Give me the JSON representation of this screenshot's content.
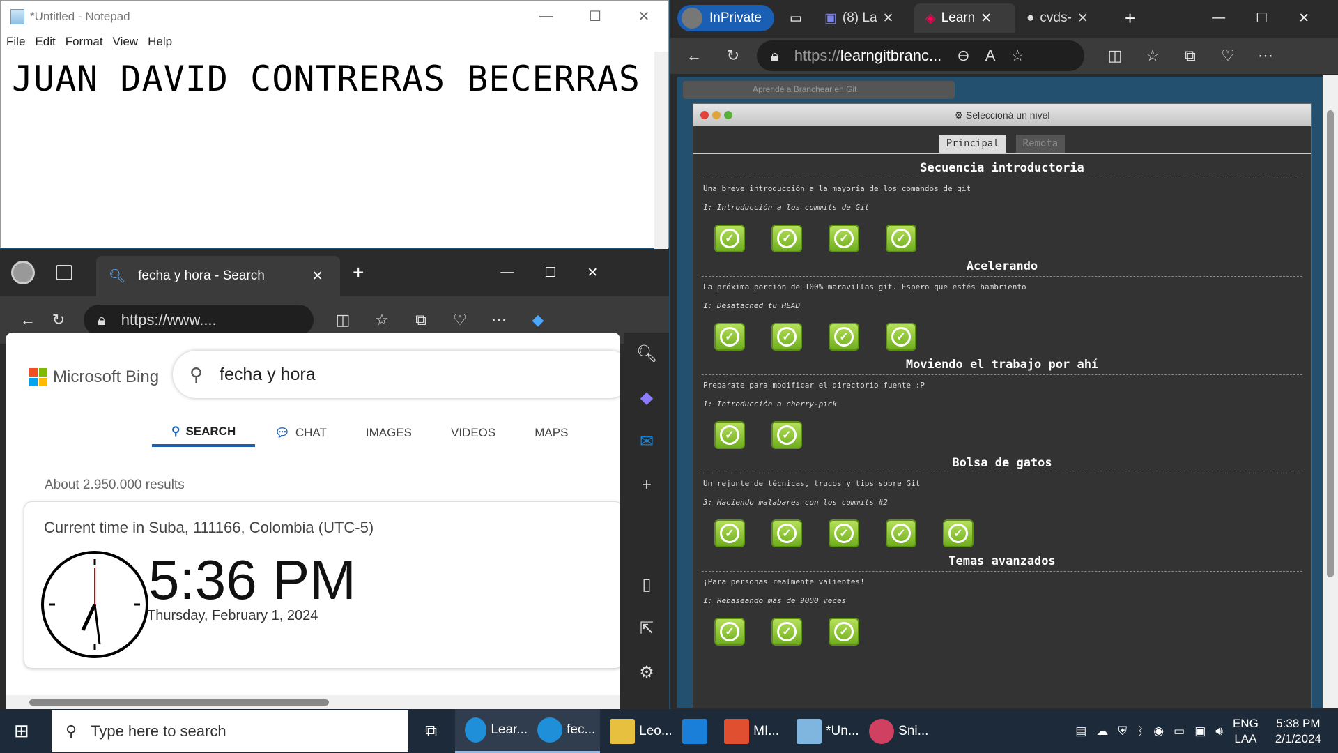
{
  "notepad": {
    "title": "*Untitled - Notepad",
    "menu": [
      "File",
      "Edit",
      "Format",
      "View",
      "Help"
    ],
    "content": "JUAN DAVID CONTRERAS BECERRAS"
  },
  "edge_small": {
    "tab_title": "fecha y hora - Search",
    "url": "https://www....",
    "bing": {
      "logo": "Microsoft Bing",
      "query": "fecha y hora",
      "nav": [
        "SEARCH",
        "CHAT",
        "IMAGES",
        "VIDEOS",
        "MAPS"
      ],
      "results": "About 2.950.000 results",
      "location": "Current time in Suba, 111166, Colombia (UTC-5)",
      "time": "5:36 PM",
      "date": "Thursday, February 1, 2024"
    }
  },
  "edge_main": {
    "inprivate": "InPrivate",
    "tabs": [
      "(8) La",
      "Learn",
      "cvds-"
    ],
    "url_prefix": "https://",
    "url_host": "learngitbranc...",
    "dialog": {
      "title": "Seleccioná un nivel",
      "back_title": "Aprendé a Branchear en Git",
      "tabs": [
        "Principal",
        "Remota"
      ],
      "sections": [
        {
          "heading": "Secuencia introductoria",
          "desc": "Una breve introducción a la mayoría de los comandos de git",
          "sub": "1: Introducción a los commits de Git",
          "levels": 4
        },
        {
          "heading": "Acelerando",
          "desc": "La próxima porción de 100% maravillas git. Espero que estés hambriento",
          "sub": "1: Desatached tu HEAD",
          "levels": 4
        },
        {
          "heading": "Moviendo el trabajo por ahí",
          "desc": "Preparate para modificar el directorio fuente :P",
          "sub": "1: Introducción a cherry-pick",
          "levels": 2
        },
        {
          "heading": "Bolsa de gatos",
          "desc": "Un rejunte de técnicas, trucos y tips sobre Git",
          "sub": "3: Haciendo malabares con los commits #2",
          "levels": 5
        },
        {
          "heading": "Temas avanzados",
          "desc": "¡Para personas realmente valientes!",
          "sub": "1: Rebaseando más de 9000 veces",
          "levels": 3
        }
      ]
    }
  },
  "taskbar": {
    "search_placeholder": "Type here to search",
    "apps": [
      "Lear...",
      "fec...",
      "Leo...",
      "",
      "MI...",
      "*Un...",
      "Sni..."
    ],
    "lang1": "ENG",
    "lang2": "LAA",
    "time": "5:38 PM",
    "date": "2/1/2024"
  }
}
